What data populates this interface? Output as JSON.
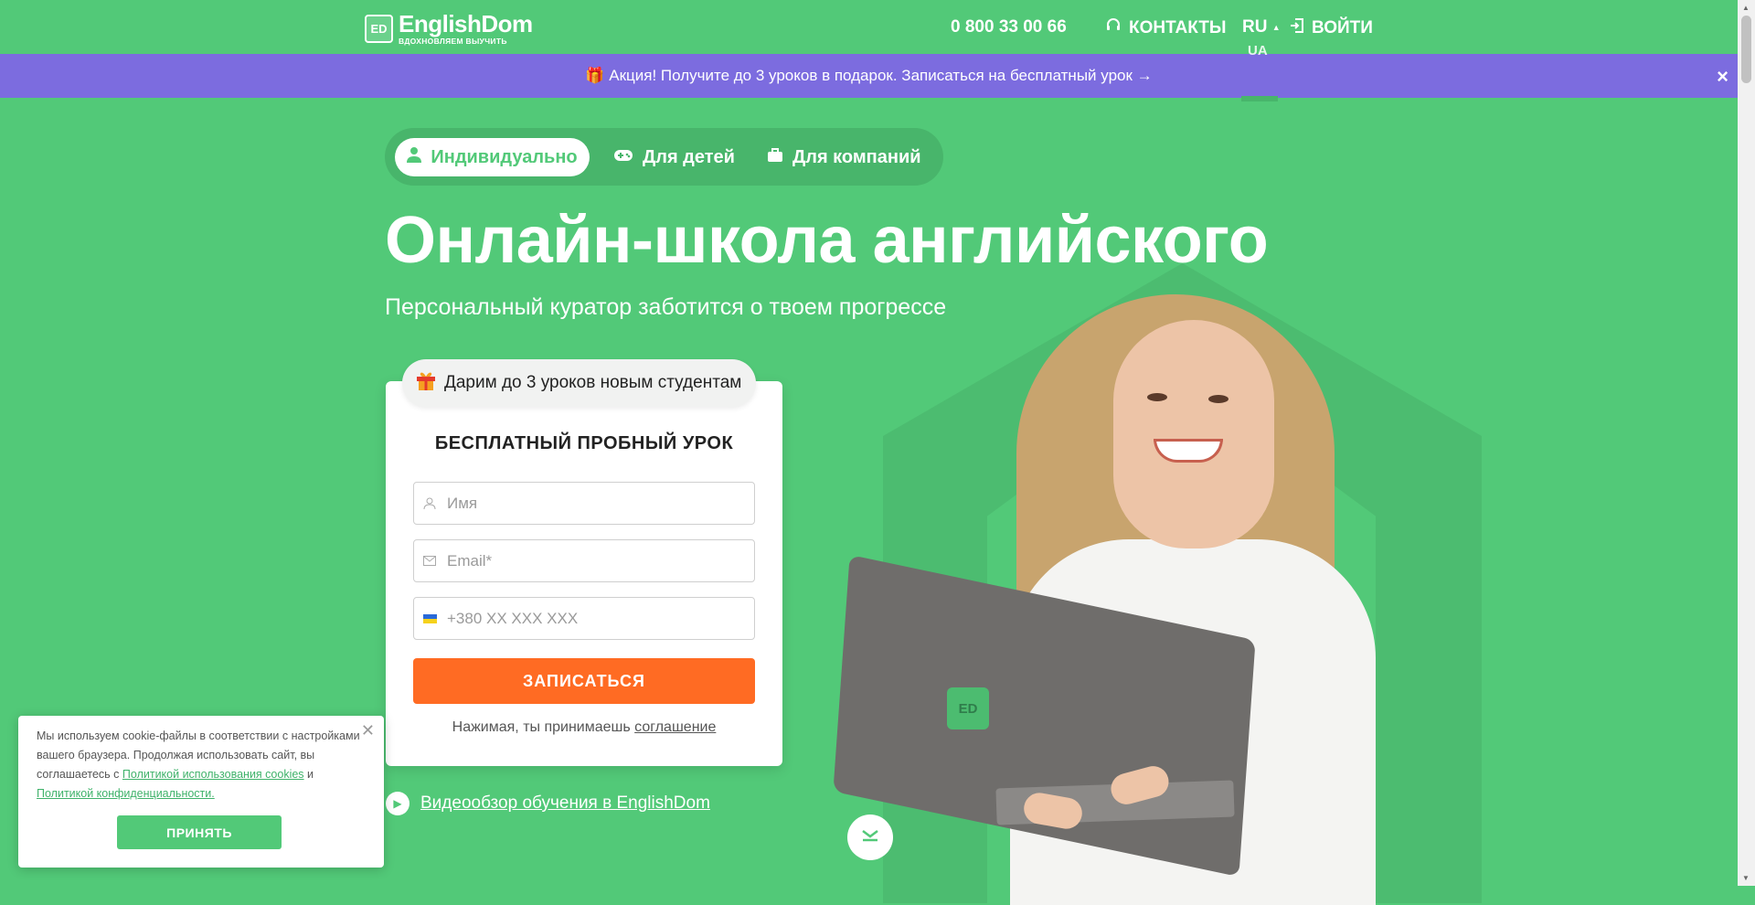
{
  "header": {
    "logo_badge": "ED",
    "logo_name": "EnglishDom",
    "logo_tagline": "ВДОХНОВЛЯЕМ ВЫУЧИТЬ",
    "phone": "0 800 33 00 66",
    "contacts_label": "КОНТАКТЫ",
    "lang_current": "RU",
    "lang_other": "UA",
    "login_label": "ВОЙТИ"
  },
  "promo": {
    "text": "🎁 Акция! Получите до 3 уроков в подарок. Записаться на бесплатный урок →",
    "close": "×"
  },
  "audience_tabs": [
    {
      "label": "Индивидуально",
      "icon": "person-icon",
      "active": true
    },
    {
      "label": "Для детей",
      "icon": "gamepad-icon",
      "active": false
    },
    {
      "label": "Для компаний",
      "icon": "briefcase-icon",
      "active": false
    }
  ],
  "hero": {
    "title": "Онлайн-школа английского",
    "subtitle": "Персональный куратор заботится о твоем прогрессе",
    "laptop_logo": "ED"
  },
  "form": {
    "badge": "Дарим до 3 уроков новым студентам",
    "title": "БЕСПЛАТНЫЙ ПРОБНЫЙ УРОК",
    "name_placeholder": "Имя",
    "email_placeholder": "Email*",
    "phone_placeholder": "+380 XX XXX XXX",
    "submit_label": "ЗАПИСАТЬСЯ",
    "agree_text": "Нажимая, ты принимаешь",
    "agree_link": "соглашение"
  },
  "video_link": "Видеообзор обучения в EnglishDom",
  "cookie": {
    "text": "Мы используем cookie-файлы в соответствии с настройками вашего браузера. Продолжая использовать сайт, вы соглашаетесь с",
    "link1": "Политикой использования cookies",
    "and": "и",
    "link2": "Политикой конфиденциальности.",
    "accept_label": "ПРИНЯТЬ"
  },
  "colors": {
    "brand_green": "#52c978",
    "promo_purple": "#7c6cdf",
    "cta_orange": "#ff6b23"
  }
}
